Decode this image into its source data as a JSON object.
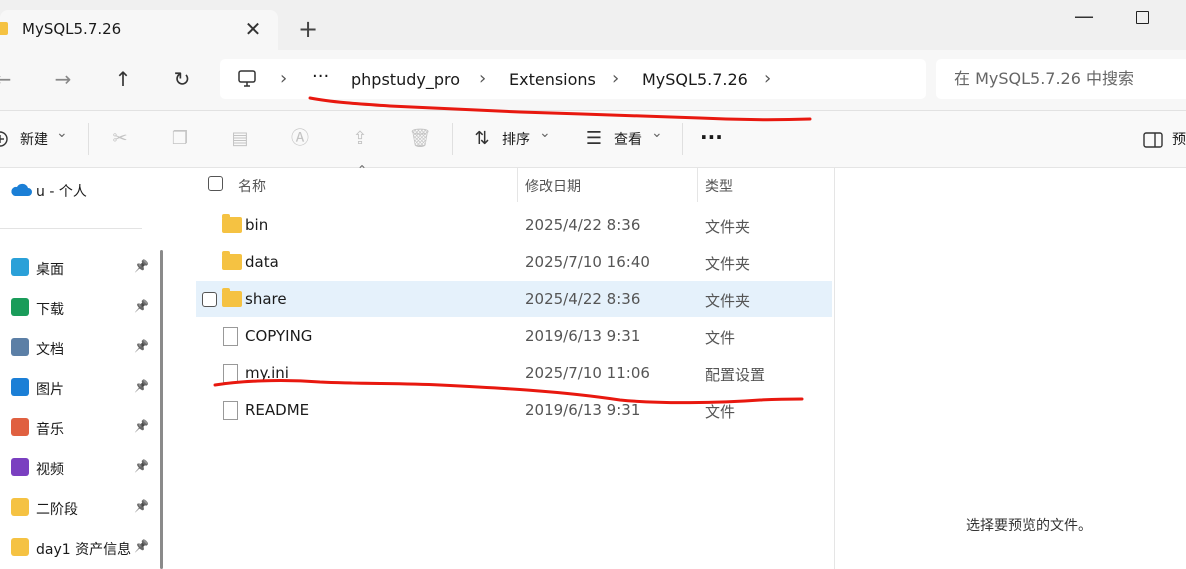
{
  "tab": {
    "title": "MySQL5.7.26",
    "close": "✕",
    "new_tab": "+"
  },
  "window": {
    "minimize": "—"
  },
  "nav": {
    "back": "←",
    "forward": "→",
    "up": "↑",
    "refresh": "↻"
  },
  "address": {
    "overflow": "···",
    "crumbs": [
      "phpstudy_pro",
      "Extensions",
      "MySQL5.7.26"
    ],
    "chevron": "›"
  },
  "search": {
    "placeholder": "在 MySQL5.7.26 中搜索"
  },
  "toolbar": {
    "new_label": "新建",
    "sort_label": "排序",
    "view_label": "查看",
    "more": "···",
    "preview_label": "预",
    "dropdown": "⌄"
  },
  "sidebar": {
    "onedrive": "u - 个人",
    "items": [
      {
        "label": "桌面",
        "color": "#2aa0d8"
      },
      {
        "label": "下载",
        "color": "#1a9c5a"
      },
      {
        "label": "文档",
        "color": "#5b7fa6"
      },
      {
        "label": "图片",
        "color": "#1b7fd6"
      },
      {
        "label": "音乐",
        "color": "#e06040"
      },
      {
        "label": "视频",
        "color": "#7a3fc0"
      },
      {
        "label": "二阶段",
        "color": "#f5c242"
      },
      {
        "label": "day1 资产信息",
        "color": "#f5c242"
      }
    ]
  },
  "columns": {
    "name": "名称",
    "date": "修改日期",
    "type": "类型"
  },
  "files": [
    {
      "name": "bin",
      "date": "2025/4/22 8:36",
      "type": "文件夹",
      "kind": "folder"
    },
    {
      "name": "data",
      "date": "2025/7/10 16:40",
      "type": "文件夹",
      "kind": "folder"
    },
    {
      "name": "share",
      "date": "2025/4/22 8:36",
      "type": "文件夹",
      "kind": "folder"
    },
    {
      "name": "COPYING",
      "date": "2019/6/13 9:31",
      "type": "文件",
      "kind": "file"
    },
    {
      "name": "my.ini",
      "date": "2025/7/10 11:06",
      "type": "配置设置",
      "kind": "config"
    },
    {
      "name": "README",
      "date": "2019/6/13 9:31",
      "type": "文件",
      "kind": "file"
    }
  ],
  "preview": {
    "empty_text": "选择要预览的文件。"
  },
  "annotation_color": "#e8180f"
}
